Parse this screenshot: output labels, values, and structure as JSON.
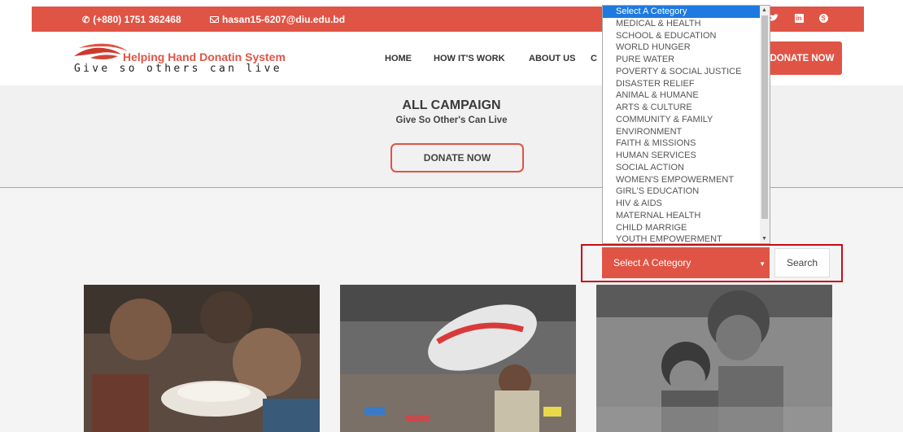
{
  "topbar": {
    "phone": "(+880) 1751 362468",
    "email": "hasan15-6207@diu.edu.bd",
    "social_icons": [
      "twitter-icon",
      "linkedin-icon",
      "skype-icon"
    ]
  },
  "brand": {
    "name": "Helping Hand Donatin System",
    "tagline": "Give so others can live"
  },
  "nav": {
    "items": [
      "HOME",
      "HOW IT'S WORK",
      "ABOUT US",
      "C"
    ],
    "donate_label": "DONATE NOW"
  },
  "hero": {
    "title": "ALL CAMPAIGN",
    "subtitle": "Give So Other's Can Live",
    "button_label": "DONATE NOW"
  },
  "category_dropdown": {
    "options": [
      "Select A Cetegory",
      "MEDICAL & HEALTH",
      "SCHOOL & EDUCATION",
      "WORLD HUNGER",
      "PURE WATER",
      "POVERTY & SOCIAL JUSTICE",
      "DISASTER RELIEF",
      "ANIMAL & HUMANE",
      "ARTS & CULTURE",
      "COMMUNITY & FAMILY",
      "ENVIRONMENT",
      "FAITH & MISSIONS",
      "HUMAN SERVICES",
      "SOCIAL ACTION",
      "WOMEN'S EMPOWERMENT",
      "GIRL'S EDUCATION",
      "HIV & AIDS",
      "MATERNAL HEALTH",
      "CHILD MARRIGE",
      "YOUTH EMPOWERMENT"
    ],
    "selected_index": 0
  },
  "search": {
    "selected_value": "Select A Cetegory",
    "button_label": "Search"
  },
  "colors": {
    "brand_red": "#e05445",
    "highlight_border": "#c90b16",
    "option_selected": "#1e7ae0"
  }
}
